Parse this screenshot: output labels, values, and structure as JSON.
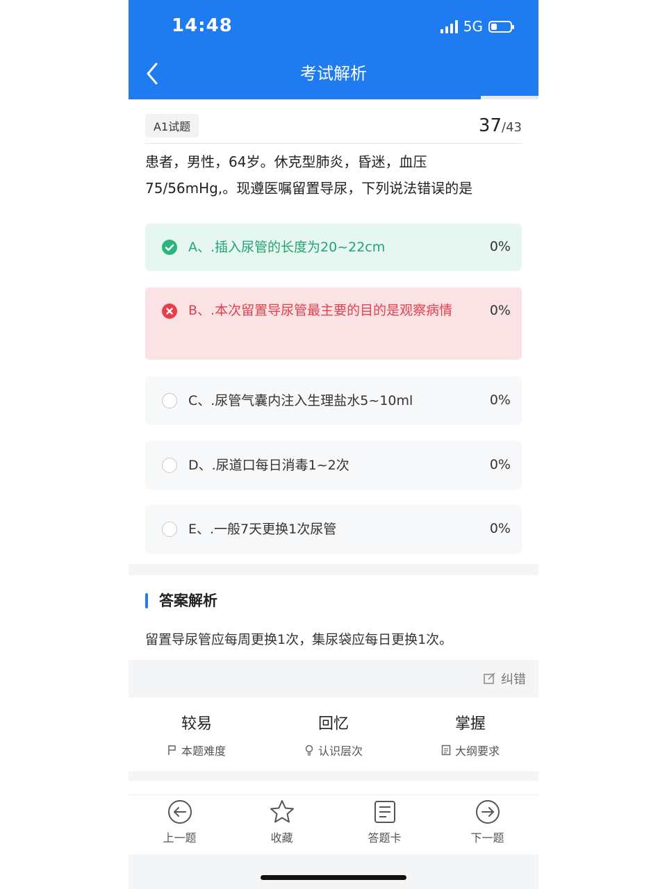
{
  "status": {
    "time": "14:48",
    "network": "5G"
  },
  "nav": {
    "title": "考试解析"
  },
  "progress": {
    "current": 37,
    "total": 43,
    "fraction": 0.86
  },
  "question": {
    "type": "A1试题",
    "number": "37",
    "separator": "/",
    "total": "43",
    "stem_line1": "患者，男性，64岁。休克型肺炎，昏迷，血压",
    "stem_line2": "75/56mHg,。现遵医嘱留置导尿，下列说法错误的是"
  },
  "options": [
    {
      "text": "A、.插入尿管的长度为20~22cm",
      "percent": "0%",
      "state": "correct"
    },
    {
      "text": "B、.本次留置导尿管最主要的目的是观察病情",
      "percent": "0%",
      "state": "wrong"
    },
    {
      "text": "C、.尿管气囊内注入生理盐水5~10ml",
      "percent": "0%",
      "state": "none"
    },
    {
      "text": "D、.尿道口每日消毒1~2次",
      "percent": "0%",
      "state": "none"
    },
    {
      "text": "E、.一般7天更换1次尿管",
      "percent": "0%",
      "state": "none"
    }
  ],
  "analysis": {
    "title": "答案解析",
    "text": "留置导尿管应每周更换1次，集尿袋应每日更换1次。",
    "correct_label": "纠错"
  },
  "meta": [
    {
      "value": "较易",
      "label": "本题难度",
      "icon": "flag-icon"
    },
    {
      "value": "回忆",
      "label": "认识层次",
      "icon": "bulb-icon"
    },
    {
      "value": "掌握",
      "label": "大纲要求",
      "icon": "document-icon"
    }
  ],
  "tabs": [
    {
      "label": "上一题",
      "icon": "arrow-left-circle-icon"
    },
    {
      "label": "收藏",
      "icon": "star-icon"
    },
    {
      "label": "答题卡",
      "icon": "answer-card-icon"
    },
    {
      "label": "下一题",
      "icon": "arrow-right-circle-icon"
    }
  ],
  "colors": {
    "primary": "#1e7cf0",
    "correct": "#2bb57e",
    "correct_bg": "#e6f6f0",
    "wrong": "#ea3d4c",
    "wrong_bg": "#fbe3e5"
  }
}
